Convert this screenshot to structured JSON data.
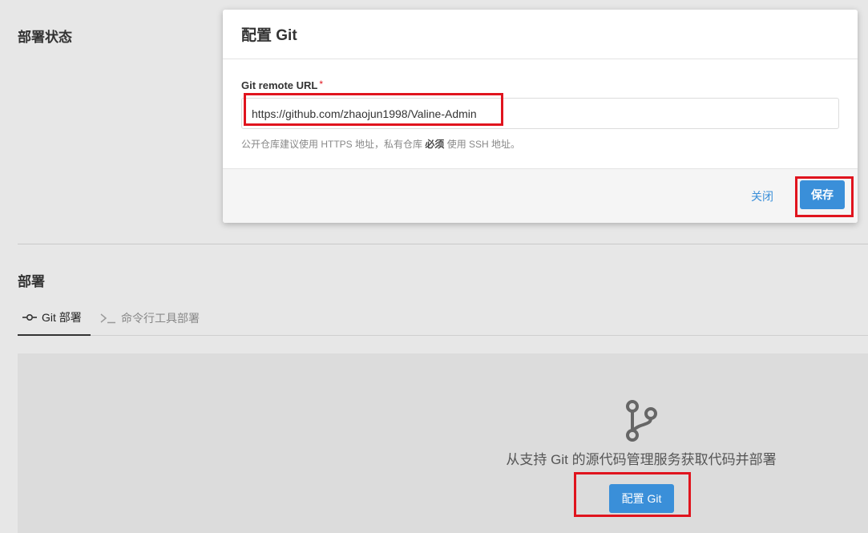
{
  "status_section": {
    "title": "部署状态"
  },
  "deploy_section": {
    "title": "部署",
    "tabs": [
      {
        "label": "Git 部署",
        "icon": "git-commit-icon",
        "active": true
      },
      {
        "label": "命令行工具部署",
        "icon": "terminal-icon",
        "active": false
      }
    ],
    "panel": {
      "icon": "git-branch-icon",
      "description": "从支持 Git 的源代码管理服务获取代码并部署",
      "button_label": "配置 Git"
    }
  },
  "modal": {
    "title": "配置 Git",
    "field_label": "Git remote URL",
    "required_mark": "*",
    "url_value": "https://github.com/zhaojun1998/Valine-Admin",
    "help_prefix": "公开仓库建议使用 HTTPS 地址，私有仓库 ",
    "help_emphasis": "必须",
    "help_suffix": " 使用 SSH 地址。",
    "close_label": "关闭",
    "save_label": "保存"
  },
  "colors": {
    "accent": "#3a8fd9",
    "highlight": "#e0141e",
    "page_background": "#e7e7e7"
  }
}
